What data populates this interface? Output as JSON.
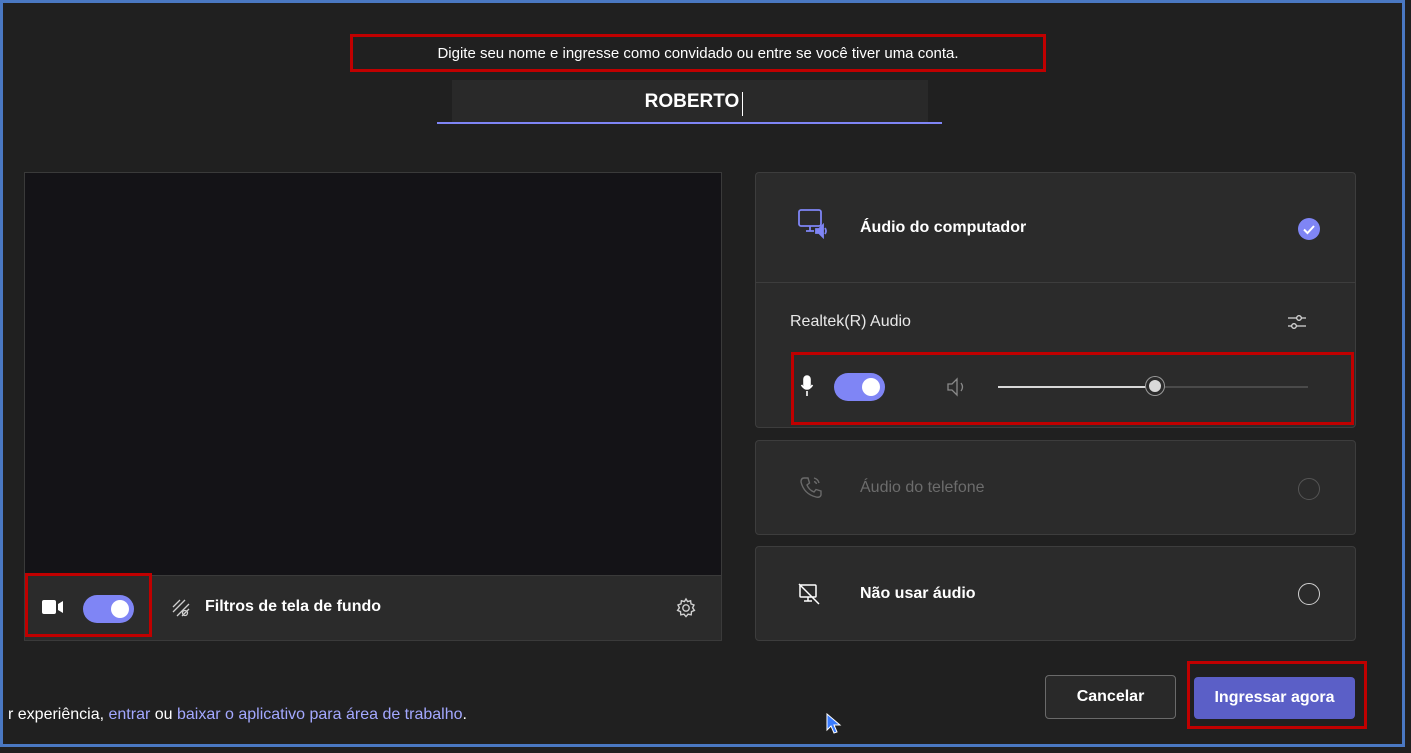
{
  "join": {
    "prompt": "Digite seu nome e ingresse como convidado ou entre se você tiver uma conta.",
    "name_value": "ROBERTO"
  },
  "video": {
    "camera_on": true,
    "background_filters_label": "Filtros de tela de fundo"
  },
  "audio_options": {
    "computer": {
      "label": "Áudio do computador",
      "selected": true,
      "device_name": "Realtek(R) Audio",
      "mic_on": true,
      "speaker_volume": 0.5
    },
    "phone": {
      "label": "Áudio do telefone",
      "selected": false,
      "disabled": true
    },
    "none": {
      "label": "Não usar áudio",
      "selected": false
    }
  },
  "buttons": {
    "cancel": "Cancelar",
    "join_now": "Ingressar agora"
  },
  "footer": {
    "text_prefix": "r experiência, ",
    "link_sign_in": "entrar",
    "text_mid": " ou ",
    "link_download": "baixar o aplicativo para área de trabalho",
    "text_suffix": "."
  },
  "colors": {
    "accent": "#7f85f5",
    "highlight_box": "#c00000",
    "background": "#202020",
    "panel": "#2b2b2b"
  },
  "icons": {
    "computer_audio": "monitor-speaker-icon",
    "device_settings": "sliders-icon",
    "mic": "microphone-icon",
    "speaker": "speaker-icon",
    "phone": "phone-icon",
    "no_audio": "monitor-slash-icon",
    "camera": "camera-icon",
    "background_filter": "background-filter-icon",
    "settings": "gear-icon",
    "cursor": "mouse-pointer-icon"
  }
}
